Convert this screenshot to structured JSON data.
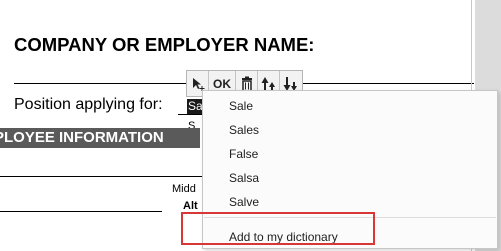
{
  "form": {
    "company_heading": "COMPANY OR EMPLOYER NAME:",
    "position_label": "Position applying for:",
    "field_value": "Sa",
    "dropdown_peek": [
      "S",
      "S"
    ],
    "section_header": "PLOYEE INFORMATION",
    "middle_label": "Midd",
    "alt_label": "Alt"
  },
  "toolbar": {
    "ok_label": "OK",
    "icons": [
      "move-icon",
      "trash-icon",
      "move-up-icon",
      "move-down-icon"
    ]
  },
  "spell_menu": {
    "suggestions": [
      "Sale",
      "Sales",
      "False",
      "Salsa",
      "Salve"
    ],
    "add_to_dictionary": "Add to my dictionary"
  },
  "colors": {
    "highlight_border": "#d93636",
    "section_bar": "#5a5a5a"
  }
}
